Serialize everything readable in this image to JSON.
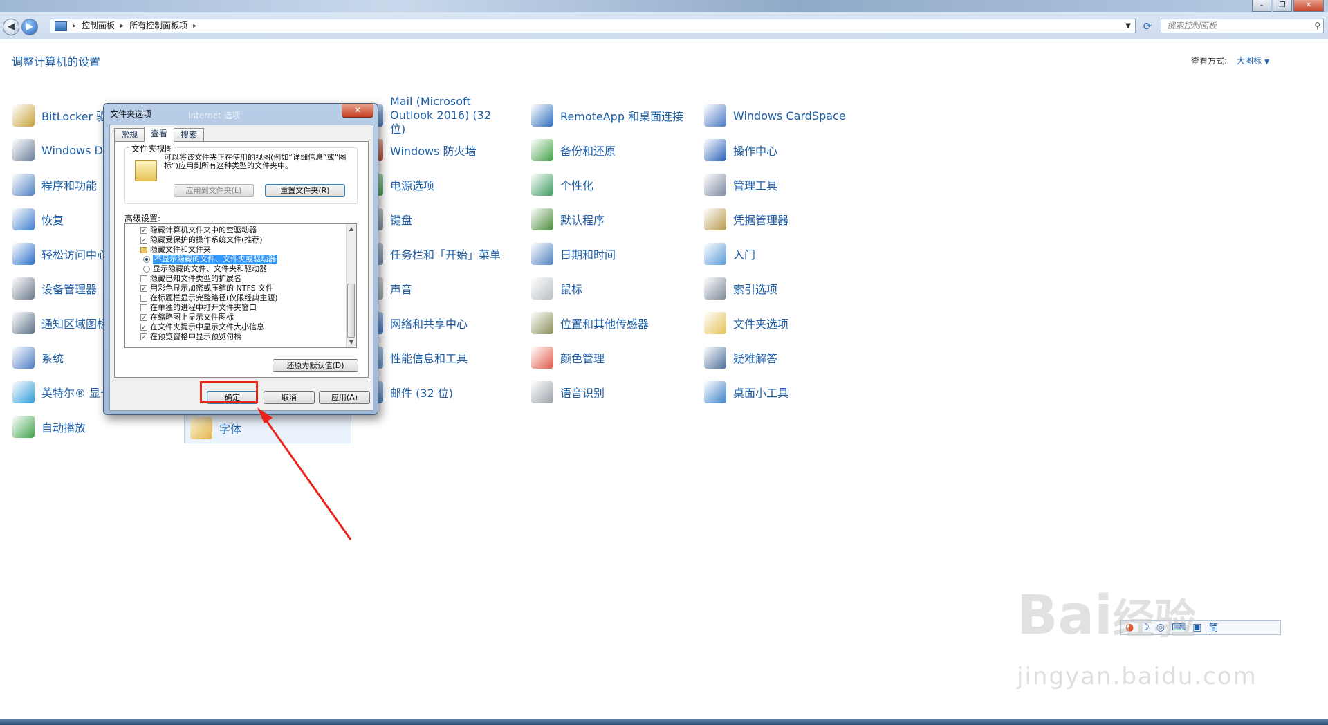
{
  "address": {
    "crumbs": [
      "控制面板",
      "所有控制面板项"
    ]
  },
  "search": {
    "placeholder": "搜索控制面板"
  },
  "page": {
    "title": "调整计算机的设置",
    "view_label": "查看方式:",
    "view_value": "大图标"
  },
  "columns": {
    "col1": [
      "BitLocker 驱",
      "Windows D",
      "程序和功能",
      "恢复",
      "轻松访问中心",
      "设备管理器",
      "通知区域图标",
      "系统",
      "英特尔® 显卡",
      "自动播放"
    ],
    "col2_visible": [
      "字体"
    ],
    "col3": [
      "Mail (Microsoft Outlook 2016) (32 位)",
      "Windows 防火墙",
      "电源选项",
      "键盘",
      "任务栏和「开始」菜单",
      "声音",
      "网络和共享中心",
      "性能信息和工具",
      "邮件 (32 位)"
    ],
    "col4": [
      "RemoteApp 和桌面连接",
      "备份和还原",
      "个性化",
      "默认程序",
      "日期和时间",
      "鼠标",
      "位置和其他传感器",
      "颜色管理",
      "语音识别"
    ],
    "col5": [
      "Windows CardSpace",
      "操作中心",
      "管理工具",
      "凭据管理器",
      "入门",
      "索引选项",
      "文件夹选项",
      "疑难解答",
      "桌面小工具"
    ]
  },
  "icon_colors": {
    "col1": [
      "#c9a23a",
      "#6b7f99",
      "#4f82c4",
      "#3d7fd0",
      "#2a6fc9",
      "#6c7a8c",
      "#5b6f88",
      "#4d7cc4",
      "#2f9bd8",
      "#3fa24a"
    ],
    "col3": [
      "#4a7fc0",
      "#b3452b",
      "#3f9a52",
      "#7c8896",
      "#6f88a8",
      "#9aa3ad",
      "#3c74c4",
      "#5a8ec8",
      "#4a7fc0"
    ],
    "col4": [
      "#2f6fbf",
      "#43a047",
      "#3c9a5f",
      "#4a8a3a",
      "#4f7fbe",
      "#b9bec4",
      "#8b8f5a",
      "#e05a4a",
      "#9aa1a8"
    ],
    "col5": [
      "#4b79c6",
      "#2a5fb8",
      "#7e8aa0",
      "#b89a4c",
      "#5a9ad6",
      "#7f8a99",
      "#e4c056",
      "#4d6f9a",
      "#3f82c8"
    ],
    "col2": [
      "#e0b44e"
    ]
  },
  "dialog": {
    "title": "文件夹选项",
    "behind_title": "Internet 选项",
    "close": "✕",
    "tabs": [
      "常规",
      "查看",
      "搜索"
    ],
    "group_label": "文件夹视图",
    "group_text": "可以将该文件夹正在使用的视图(例如“详细信息”或“图标”)应用到所有这种类型的文件夹中。",
    "apply_folders": "应用到文件夹(L)",
    "reset_folders": "重置文件夹(R)",
    "advanced_label": "高级设置:",
    "rows": [
      {
        "type": "check",
        "checked": true,
        "text": "隐藏计算机文件夹中的空驱动器"
      },
      {
        "type": "check",
        "checked": true,
        "text": "隐藏受保护的操作系统文件(推荐)"
      },
      {
        "type": "folder",
        "text": "隐藏文件和文件夹"
      },
      {
        "type": "radio",
        "checked": true,
        "selected": true,
        "text": "不显示隐藏的文件、文件夹或驱动器"
      },
      {
        "type": "radio",
        "checked": false,
        "text": "显示隐藏的文件、文件夹和驱动器"
      },
      {
        "type": "check",
        "checked": false,
        "text": "隐藏已知文件类型的扩展名"
      },
      {
        "type": "check",
        "checked": true,
        "text": "用彩色显示加密或压缩的 NTFS 文件"
      },
      {
        "type": "check",
        "checked": false,
        "text": "在标题栏显示完整路径(仅限经典主题)"
      },
      {
        "type": "check",
        "checked": false,
        "text": "在单独的进程中打开文件夹窗口"
      },
      {
        "type": "check",
        "checked": true,
        "text": "在缩略图上显示文件图标"
      },
      {
        "type": "check",
        "checked": true,
        "text": "在文件夹提示中显示文件大小信息"
      },
      {
        "type": "check",
        "checked": true,
        "text": "在预览窗格中显示预览句柄"
      }
    ],
    "restore_defaults": "还原为默认值(D)",
    "ok": "确定",
    "cancel": "取消",
    "apply": "应用(A)"
  },
  "watermark": {
    "brand": "Bai",
    "brand2": "经验",
    "url": "jingyan.baidu.com"
  },
  "ime": {
    "label": "简"
  }
}
